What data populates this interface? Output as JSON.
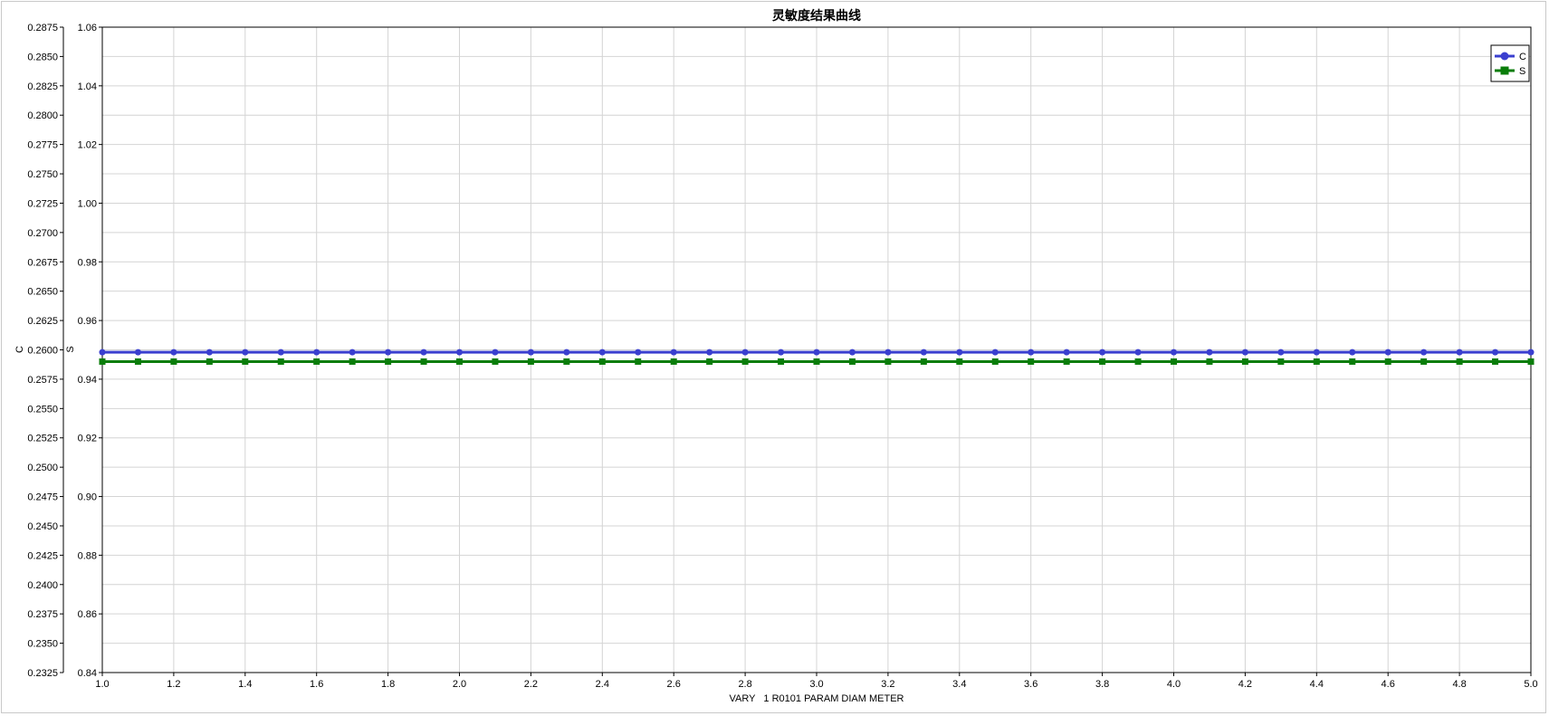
{
  "chart_data": {
    "type": "line",
    "title": "灵敏度结果曲线",
    "xlabel": "VARY   1 R0101 PARAM DIAM METER",
    "ylabel_left": "C",
    "ylabel_right": "S",
    "x": [
      1.0,
      1.1,
      1.2,
      1.3,
      1.4,
      1.5,
      1.6,
      1.7,
      1.8,
      1.9,
      2.0,
      2.1,
      2.2,
      2.3,
      2.4,
      2.5,
      2.6,
      2.7,
      2.8,
      2.9,
      3.0,
      3.1,
      3.2,
      3.3,
      3.4,
      3.5,
      3.6,
      3.7,
      3.8,
      3.9,
      4.0,
      4.1,
      4.2,
      4.3,
      4.4,
      4.5,
      4.6,
      4.7,
      4.8,
      4.9,
      5.0
    ],
    "xlim": [
      1.0,
      5.0
    ],
    "x_ticks": [
      "1.0",
      "1.2",
      "1.4",
      "1.6",
      "1.8",
      "2.0",
      "2.2",
      "2.4",
      "2.6",
      "2.8",
      "3.0",
      "3.2",
      "3.4",
      "3.6",
      "3.8",
      "4.0",
      "4.2",
      "4.4",
      "4.6",
      "4.8",
      "5.0"
    ],
    "y_left_lim": [
      0.2325,
      0.2875
    ],
    "y_left_ticks": [
      "0.2875",
      "0.2850",
      "0.2825",
      "0.2800",
      "0.2775",
      "0.2750",
      "0.2725",
      "0.2700",
      "0.2675",
      "0.2650",
      "0.2625",
      "0.2600",
      "0.2575",
      "0.2550",
      "0.2525",
      "0.2500",
      "0.2475",
      "0.2450",
      "0.2425",
      "0.2400",
      "0.2375",
      "0.2350",
      "0.2325"
    ],
    "y_right_lim": [
      0.84,
      1.06
    ],
    "y_right_ticks": [
      "1.06",
      "1.04",
      "1.02",
      "1.00",
      "0.98",
      "0.96",
      "0.94",
      "0.92",
      "0.90",
      "0.88",
      "0.86",
      "0.84"
    ],
    "grid": true,
    "legend_position": "top-right",
    "series": [
      {
        "name": "C",
        "axis": "left",
        "color": "#3a3fcf",
        "marker": "circle",
        "values": [
          0.2598,
          0.2598,
          0.2598,
          0.2598,
          0.2598,
          0.2598,
          0.2598,
          0.2598,
          0.2598,
          0.2598,
          0.2598,
          0.2598,
          0.2598,
          0.2598,
          0.2598,
          0.2598,
          0.2598,
          0.2598,
          0.2598,
          0.2598,
          0.2598,
          0.2598,
          0.2598,
          0.2598,
          0.2598,
          0.2598,
          0.2598,
          0.2598,
          0.2598,
          0.2598,
          0.2598,
          0.2598,
          0.2598,
          0.2598,
          0.2598,
          0.2598,
          0.2598,
          0.2598,
          0.2598,
          0.2598,
          0.2598
        ]
      },
      {
        "name": "S",
        "axis": "right",
        "color": "#0a7d0a",
        "marker": "square",
        "values": [
          0.946,
          0.946,
          0.946,
          0.946,
          0.946,
          0.946,
          0.946,
          0.946,
          0.946,
          0.946,
          0.946,
          0.946,
          0.946,
          0.946,
          0.946,
          0.946,
          0.946,
          0.946,
          0.946,
          0.946,
          0.946,
          0.946,
          0.946,
          0.946,
          0.946,
          0.946,
          0.946,
          0.946,
          0.946,
          0.946,
          0.946,
          0.946,
          0.946,
          0.946,
          0.946,
          0.946,
          0.946,
          0.946,
          0.946,
          0.946,
          0.946
        ]
      }
    ]
  }
}
